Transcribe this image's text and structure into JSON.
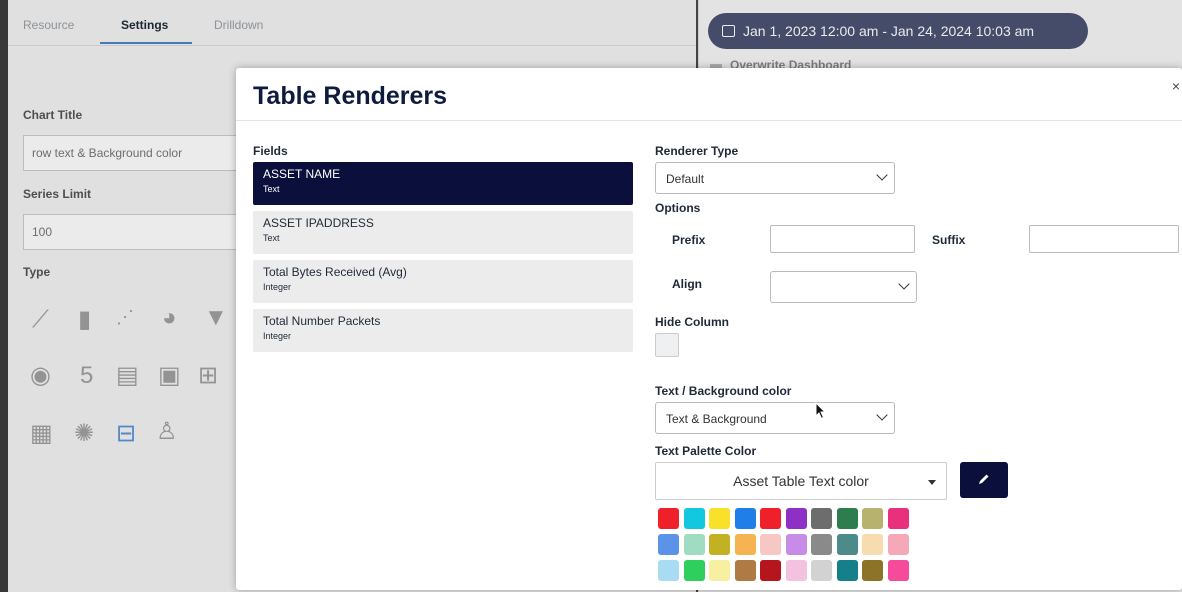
{
  "background": {
    "tabs": [
      "Resource",
      "Settings",
      "Drilldown"
    ],
    "chart_title_label": "Chart Title",
    "chart_title_value": "row text & Background color",
    "series_limit_label": "Series Limit",
    "series_limit_value": "100",
    "type_label": "Type",
    "date_range": "Jan 1, 2023 12:00 am - Jan 24, 2024 10:03 am",
    "overwrite_label": "Overwrite Dashboard"
  },
  "modal": {
    "title": "Table Renderers",
    "fields_label": "Fields",
    "fields": [
      {
        "name": "ASSET NAME",
        "type": "Text"
      },
      {
        "name": "ASSET IPADDRESS",
        "type": "Text"
      },
      {
        "name": "Total Bytes Received (Avg)",
        "type": "Integer"
      },
      {
        "name": "Total Number Packets",
        "type": "Integer"
      }
    ],
    "renderer_type_label": "Renderer Type",
    "renderer_type_value": "Default",
    "options_label": "Options",
    "prefix_label": "Prefix",
    "suffix_label": "Suffix",
    "align_label": "Align",
    "align_value": "",
    "hide_column_label": "Hide Column",
    "text_bg_label": "Text / Background color",
    "text_bg_value": "Text & Background",
    "palette_label": "Text Palette Color",
    "palette_value": "Asset Table Text color"
  },
  "colors": {
    "accent": "#0b0f3b",
    "swatches": [
      [
        "#f0202a",
        "#12c8e0",
        "#f7e12a",
        "#1f7ee8",
        "#f0202a",
        "#8e2fc5",
        "#6d6d6d",
        "#2e7d4f",
        "#b7b26e",
        "#e8307c"
      ],
      [
        "#5b93e8",
        "#9fdcc2",
        "#c2b223",
        "#f5b352",
        "#f7c7c4",
        "#c78be8",
        "#8a8a8a",
        "#4d8a8a",
        "#f7dcb0",
        "#f5a8b8"
      ],
      [
        "#a9dcf2",
        "#2fcf5e",
        "#f7f0a0",
        "#b07a44",
        "#b5161e",
        "#f2c2e0",
        "#d2d2d2",
        "#157f8a",
        "#8c7328",
        "#f54b9a"
      ]
    ]
  }
}
